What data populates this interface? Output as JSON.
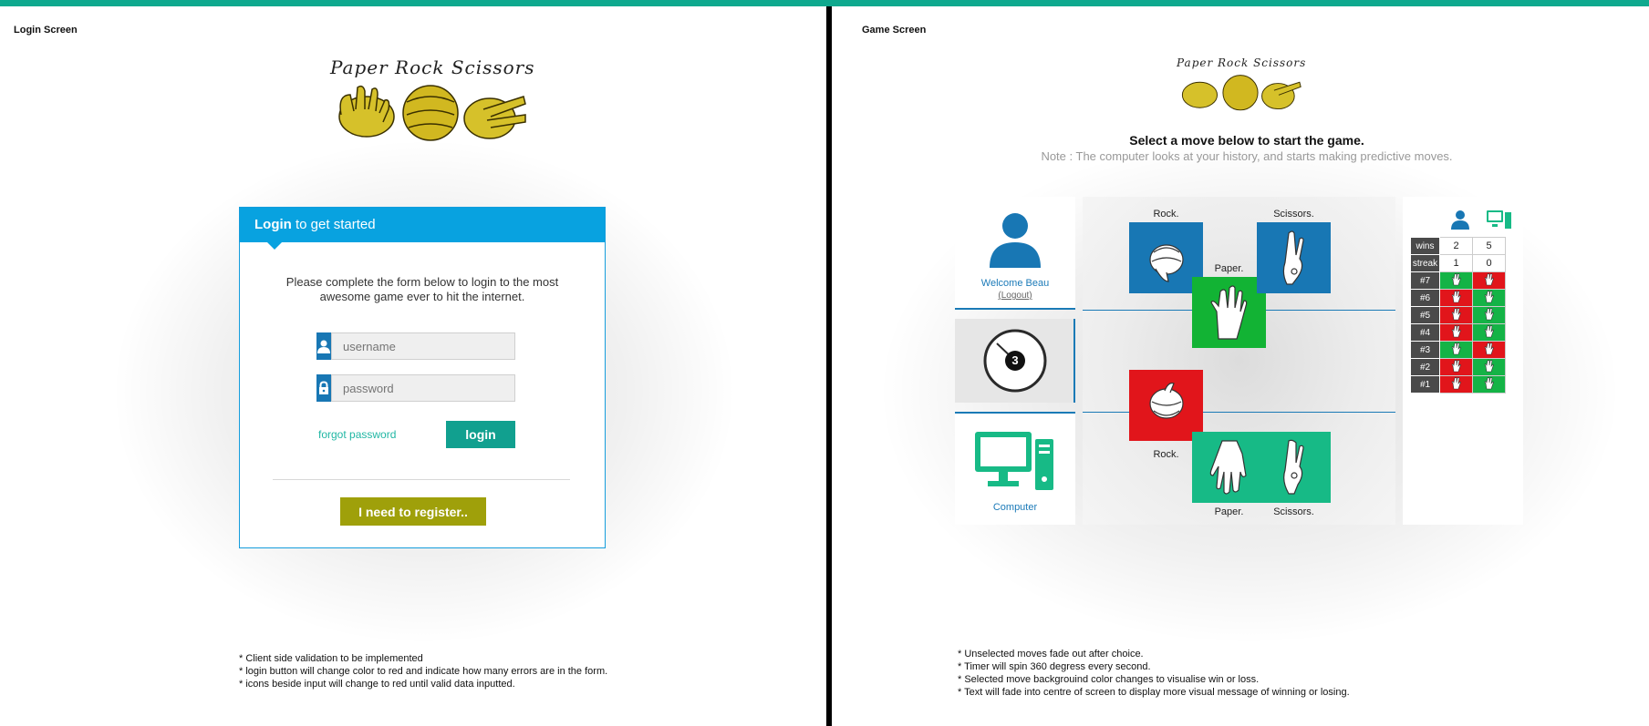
{
  "login_screen": {
    "title": "Login Screen",
    "logo_text": "Paper  Rock  Scissors",
    "header_bold": "Login",
    "header_rest": " to get started",
    "intro": "Please complete the form below to login to the most awesome game ever to hit the internet.",
    "username_placeholder": "username",
    "password_placeholder": "password",
    "forgot": "forgot password",
    "login_button": "login",
    "register_button": "I need to register..",
    "notes": [
      "* Client side validation to be implemented",
      "* login button will change color to red and indicate how many errors are in the form.",
      "* icons beside input will change to red until valid data inputted."
    ]
  },
  "game_screen": {
    "title": "Game Screen",
    "logo_text": "Paper  Rock  Scissors",
    "heading": "Select a move below to start the game.",
    "note": "Note : The computer looks at your history, and starts making predictive moves.",
    "player": {
      "welcome": "Welcome Beau",
      "logout": "(Logout)"
    },
    "timer": "3",
    "computer_label": "Computer",
    "player_moves": [
      {
        "label": "Rock.",
        "color": "#1877b4"
      },
      {
        "label": "Paper.",
        "color": "#12b334"
      },
      {
        "label": "Scissors.",
        "color": "#1877b4"
      }
    ],
    "computer_moves": [
      {
        "label": "Rock.",
        "color": "#e1151b"
      },
      {
        "label": "Paper.",
        "color": "#17ba86"
      },
      {
        "label": "Scissors.",
        "color": "#17ba86"
      }
    ],
    "scoreboard": {
      "wins_label": "wins",
      "streak_label": "streak",
      "player_wins": "2",
      "computer_wins": "5",
      "player_streak": "1",
      "computer_streak": "0",
      "rounds": [
        {
          "label": "#7",
          "player": "win",
          "computer": "loss"
        },
        {
          "label": "#6",
          "player": "loss",
          "computer": "win"
        },
        {
          "label": "#5",
          "player": "loss",
          "computer": "win"
        },
        {
          "label": "#4",
          "player": "loss",
          "computer": "win"
        },
        {
          "label": "#3",
          "player": "win",
          "computer": "loss"
        },
        {
          "label": "#2",
          "player": "loss",
          "computer": "win"
        },
        {
          "label": "#1",
          "player": "loss",
          "computer": "win"
        }
      ]
    },
    "notes": [
      "* Unselected moves fade out after choice.",
      "* Timer will spin 360 degress every second.",
      "* Selected move backgrouind color changes  to visualise win or loss.",
      "* Text will fade into centre of screen to display more visual message of winning or losing."
    ]
  },
  "colors": {
    "accent_teal": "#0ea98e",
    "login_blue": "#08a2e0",
    "register_olive": "#9fa00a",
    "win_green": "#14b346",
    "loss_red": "#e1151b"
  }
}
